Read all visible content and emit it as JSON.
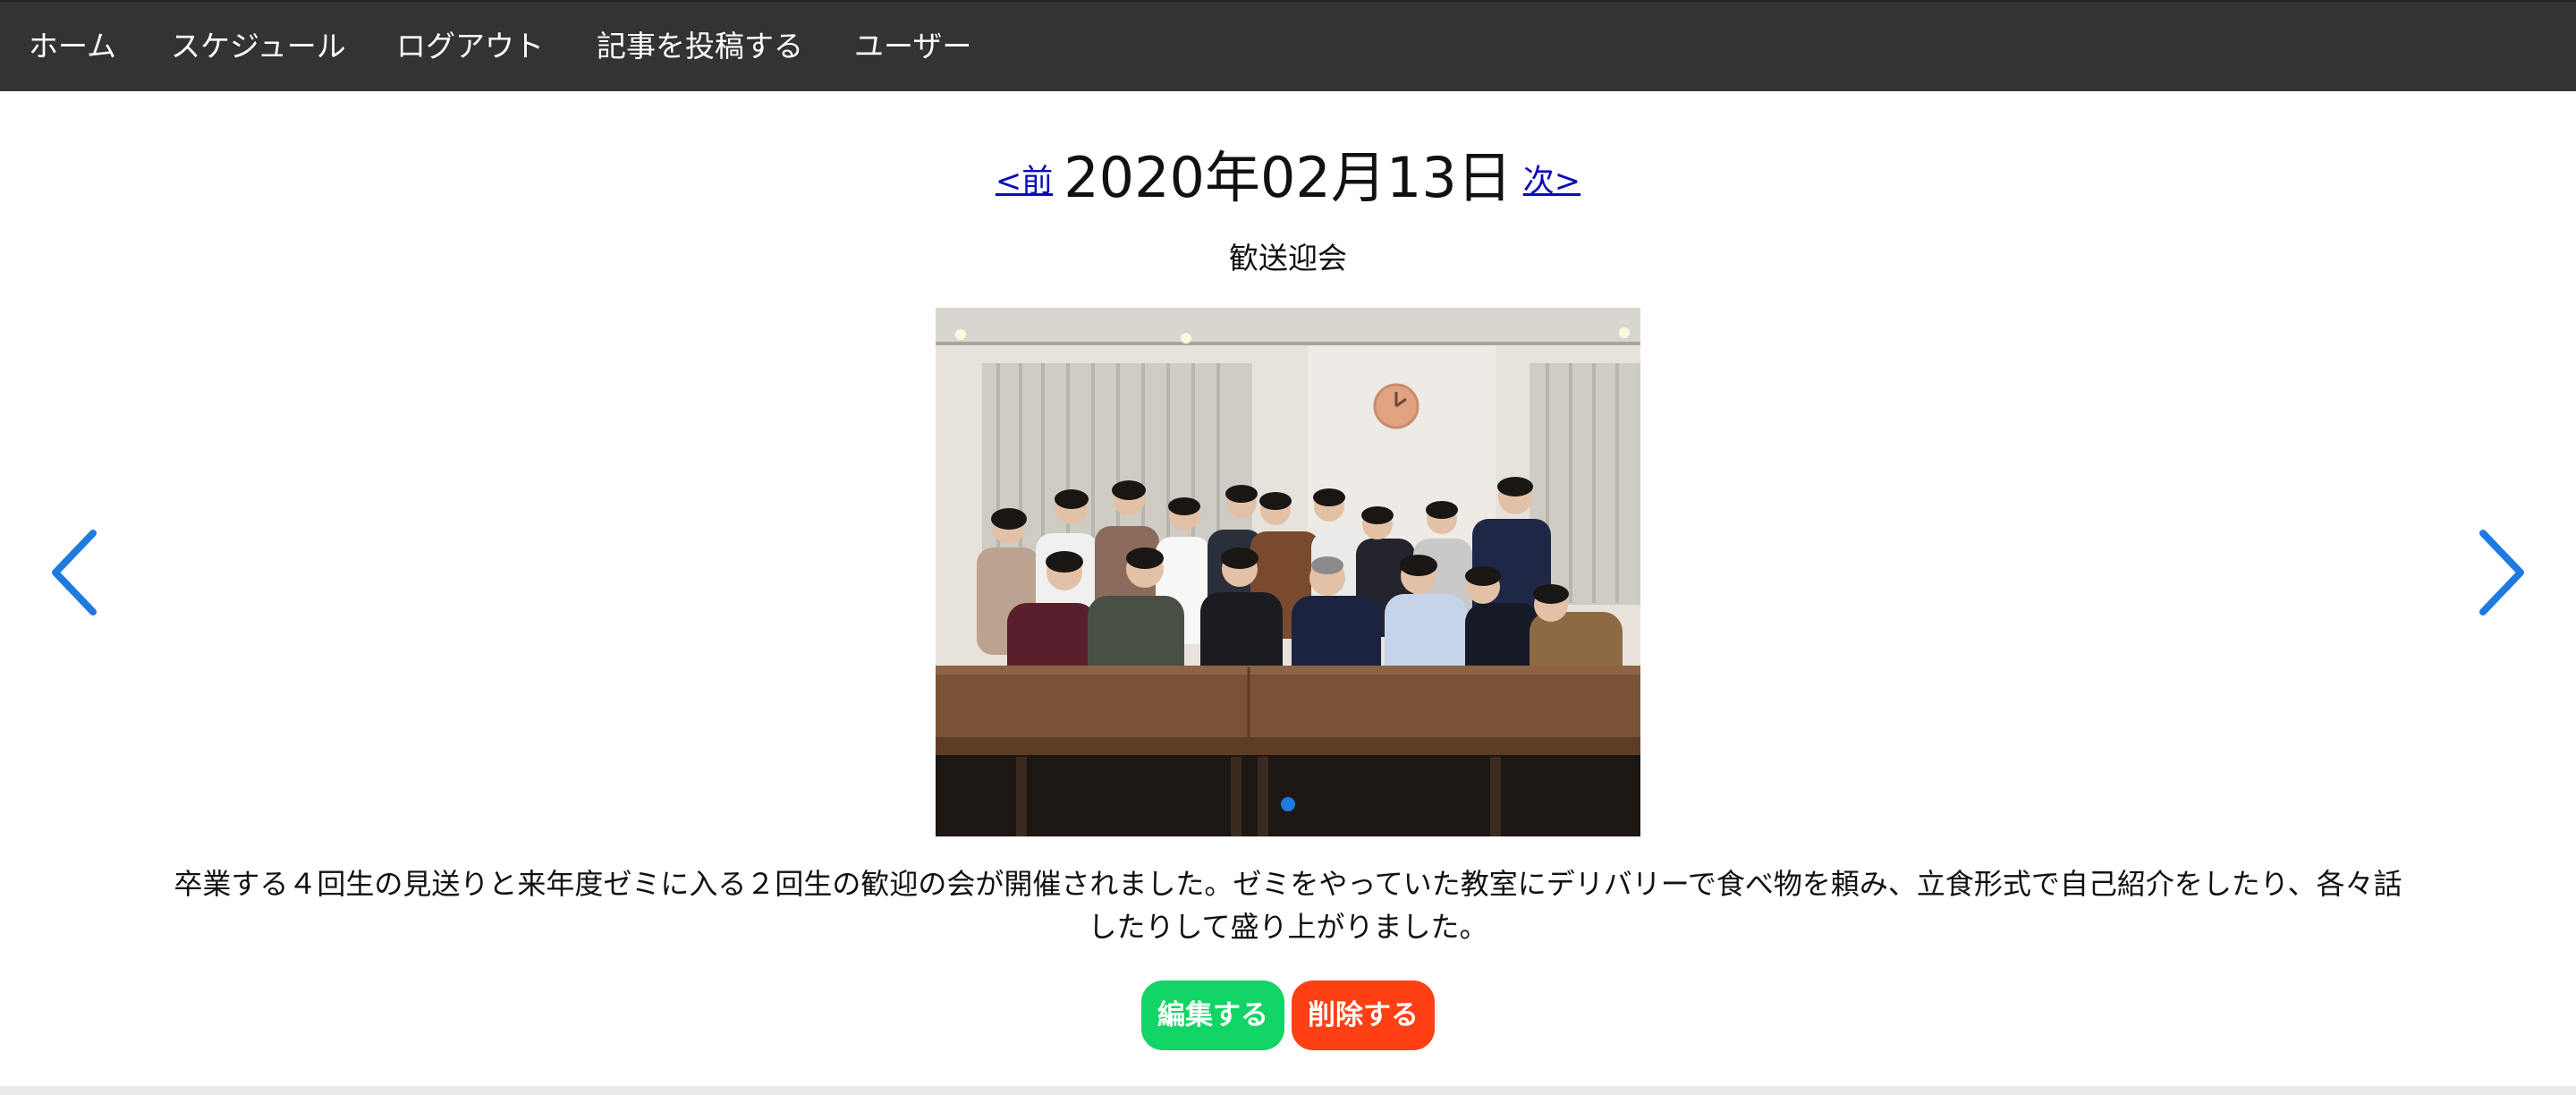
{
  "nav": {
    "home": "ホーム",
    "schedule": "スケジュール",
    "logout": "ログアウト",
    "post_article": "記事を投稿する",
    "users": "ユーザー"
  },
  "date_nav": {
    "prev": "<前",
    "date": "2020年02月13日",
    "next": "次>"
  },
  "event": {
    "title": "歓送迎会",
    "description": "卒業する４回生の見送りと来年度ゼミに入る２回生の歓迎の会が開催されました。ゼミをやっていた教室にデリバリーで食べ物を頼み、立食形式で自己紹介をしたり、各々話したりして盛り上がりました。"
  },
  "carousel": {
    "prev_icon": "chevron-left-icon",
    "next_icon": "chevron-right-icon",
    "slide_count": 1,
    "active_slide": 1
  },
  "actions": {
    "edit": "編集する",
    "delete": "削除する"
  },
  "colors": {
    "navbar": "#333333",
    "link": "#0b0bb8",
    "carousel_arrow": "#1f7ae0",
    "edit_button": "#13d566",
    "delete_button": "#ff3f14"
  }
}
